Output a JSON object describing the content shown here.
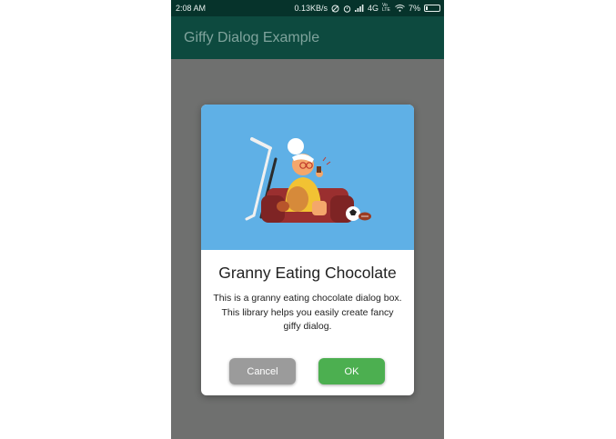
{
  "status_bar": {
    "time": "2:08 AM",
    "speed": "0.13KB/s",
    "network": "4G",
    "volte": "Vo LTE",
    "battery_percent": "7%"
  },
  "app_bar": {
    "title": "Giffy Dialog Example"
  },
  "dialog": {
    "image_name": "granny-eating-chocolate",
    "title": "Granny Eating Chocolate",
    "message": "This is a granny eating chocolate dialog box. This library helps you easily create fancy giffy dialog.",
    "cancel_label": "Cancel",
    "ok_label": "OK"
  },
  "colors": {
    "status_bar": "#06332b",
    "app_bar": "#0d4a3f",
    "scrim": "#6f706f",
    "gif_background": "#5fb0e6",
    "cancel_button": "#9b9b9b",
    "ok_button": "#4caf50"
  }
}
